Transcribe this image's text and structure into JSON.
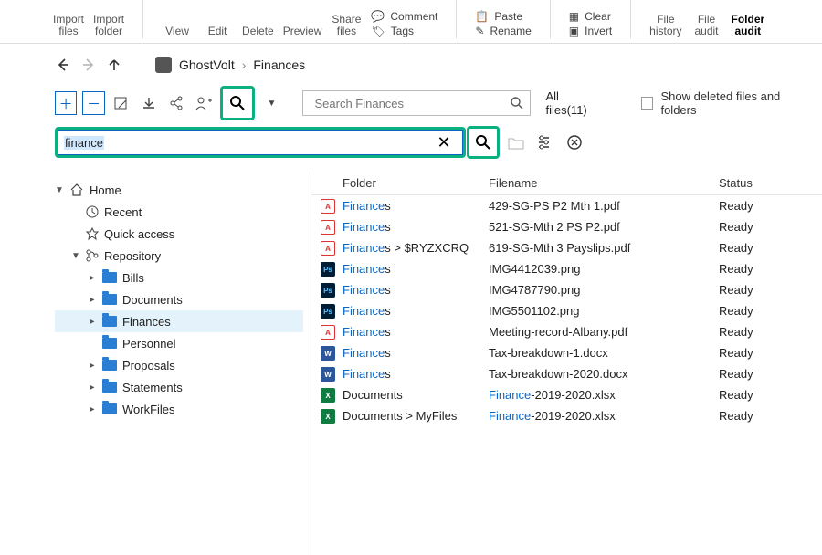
{
  "ribbon": {
    "import_files": "Import\nfiles",
    "import_folder": "Import\nfolder",
    "view": "View",
    "edit": "Edit",
    "delete": "Delete",
    "preview": "Preview",
    "share_files": "Share\nfiles",
    "comment": "Comment",
    "tags": "Tags",
    "paste": "Paste",
    "rename": "Rename",
    "clear": "Clear",
    "invert": "Invert",
    "file_history": "File\nhistory",
    "file_audit": "File\naudit",
    "folder_audit": "Folder\naudit"
  },
  "breadcrumb": {
    "root": "GhostVolt",
    "current": "Finances"
  },
  "toolbar": {
    "search_placeholder": "Search Finances",
    "all_files": "All files(11)",
    "show_deleted": "Show deleted files and folders"
  },
  "find": {
    "value": "finance"
  },
  "tree": {
    "home": "Home",
    "recent": "Recent",
    "quick": "Quick access",
    "repo": "Repository",
    "items": [
      "Bills",
      "Documents",
      "Finances",
      "Personnel",
      "Proposals",
      "Statements",
      "WorkFiles"
    ],
    "active": "Finances"
  },
  "columns": {
    "folder": "Folder",
    "filename": "Filename",
    "status": "Status"
  },
  "rows": [
    {
      "icon": "pdf",
      "folder_hl": "Finance",
      "folder_rest": "s",
      "file_plain": "429-SG-PS P2 Mth 1.pdf",
      "status": "Ready"
    },
    {
      "icon": "pdf",
      "folder_hl": "Finance",
      "folder_rest": "s",
      "file_plain": "521-SG-Mth 2 PS P2.pdf",
      "status": "Ready"
    },
    {
      "icon": "pdf",
      "folder_hl": "Finance",
      "folder_rest": "s > $RYZXCRQ",
      "file_plain": "619-SG-Mth 3 Payslips.pdf",
      "status": "Ready"
    },
    {
      "icon": "ps",
      "folder_hl": "Finance",
      "folder_rest": "s",
      "file_plain": "IMG4412039.png",
      "status": "Ready"
    },
    {
      "icon": "ps",
      "folder_hl": "Finance",
      "folder_rest": "s",
      "file_plain": "IMG4787790.png",
      "status": "Ready"
    },
    {
      "icon": "ps",
      "folder_hl": "Finance",
      "folder_rest": "s",
      "file_plain": "IMG5501102.png",
      "status": "Ready"
    },
    {
      "icon": "pdf",
      "folder_hl": "Finance",
      "folder_rest": "s",
      "file_plain": "Meeting-record-Albany.pdf",
      "status": "Ready"
    },
    {
      "icon": "doc",
      "folder_hl": "Finance",
      "folder_rest": "s",
      "file_plain": "Tax-breakdown-1.docx",
      "status": "Ready"
    },
    {
      "icon": "doc",
      "folder_hl": "Finance",
      "folder_rest": "s",
      "file_plain": "Tax-breakdown-2020.docx",
      "status": "Ready"
    },
    {
      "icon": "xls",
      "folder_plain": "Documents",
      "file_hl": "Finance",
      "file_rest": "-2019-2020.xlsx",
      "status": "Ready"
    },
    {
      "icon": "xls",
      "folder_plain": "Documents > MyFiles",
      "file_hl": "Finance",
      "file_rest": "-2019-2020.xlsx",
      "status": "Ready"
    }
  ],
  "icon_labels": {
    "pdf": "A",
    "ps": "Ps",
    "doc": "W",
    "xls": "X"
  }
}
